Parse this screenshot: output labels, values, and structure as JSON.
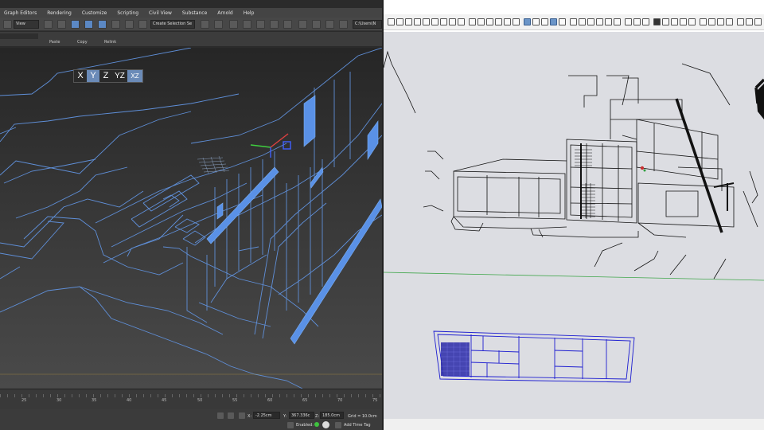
{
  "max": {
    "menu": [
      "Graph Editors",
      "Rendering",
      "Customize",
      "Scripting",
      "Civil View",
      "Substance",
      "Arnold",
      "Help"
    ],
    "toolbar": {
      "view_dropdown": "View",
      "selection_set_dropdown": "Create Selection Se",
      "path_field": "C:\\Users\\N"
    },
    "ribbon": {
      "paste_label": "Paste",
      "copy_label": "Copy",
      "relink_label": "Relink"
    },
    "axis_constraints": {
      "x": "X",
      "y": "Y",
      "z": "Z",
      "yz": "YZ",
      "xz": "XZ"
    },
    "timeline_ticks": [
      "25",
      "30",
      "35",
      "40",
      "45",
      "50",
      "55",
      "60",
      "65",
      "70",
      "75"
    ],
    "status": {
      "x_label": "X:",
      "x_value": "-2.25cm",
      "y_label": "Y:",
      "y_value": "367.336c",
      "z_label": "Z:",
      "z_value": "185.0cm",
      "grid_label": "Grid = 10.0cm",
      "enabled_label": "Enabled:",
      "add_time_tag": "Add Time Tag"
    },
    "colors": {
      "wire": "#5a8fe0",
      "wire_dim": "#5f8fd8",
      "wire_fill": "#5a91e6",
      "background": "#2b2b2b"
    }
  },
  "sketchup": {
    "colors": {
      "canvas": "#dcdde2",
      "line": "#111111",
      "selection": "#1c1cd0",
      "green_axis": "#3fa64a"
    }
  }
}
